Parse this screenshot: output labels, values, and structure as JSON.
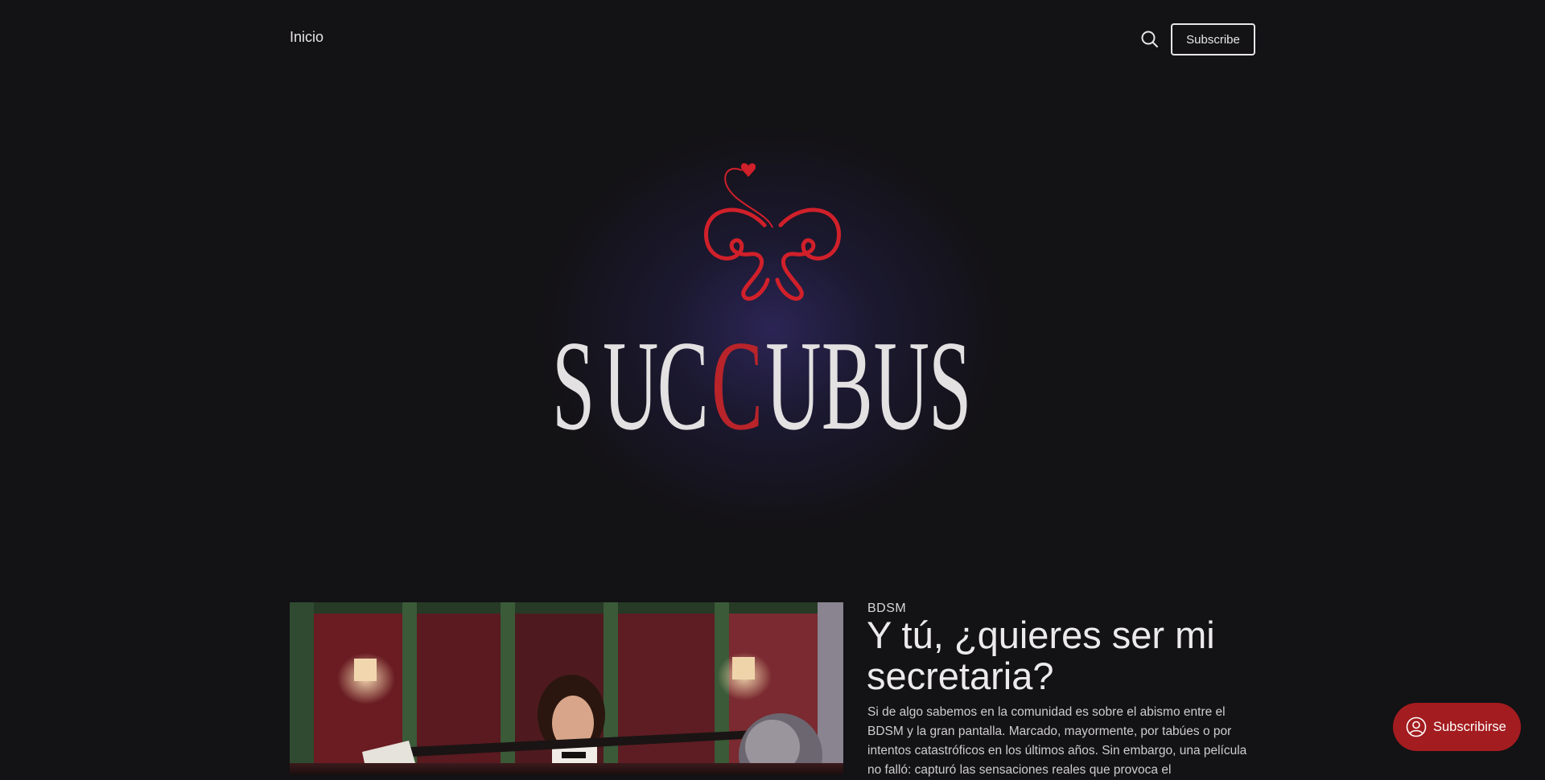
{
  "header": {
    "nav": [
      {
        "label": "Inicio"
      }
    ],
    "search_icon": "search-icon",
    "subscribe_label": "Subscribe"
  },
  "hero": {
    "logo_letters": [
      "S",
      "U",
      "C",
      "C",
      "U",
      "B",
      "U",
      "S"
    ],
    "logo_accent_letter_index": 3,
    "colors": {
      "brand_red": "#d0202a",
      "accent_red": "#b8242a",
      "letters": "#e3e1e1",
      "glow": "#302860"
    }
  },
  "featured": {
    "tag": "BDSM",
    "title": "Y tú, ¿quieres ser mi secretaria?",
    "excerpt": "Si de algo sabemos en la comunidad es sobre el abismo entre el BDSM y la gran pantalla. Marcado, mayormente, por tabúes o por intentos catastróficos en los últimos años. Sin embargo, una película no falló: capturó las sensaciones reales que provoca el"
  },
  "portal": {
    "label": "Subscribirse",
    "icon": "user-circle-icon",
    "color": "#a31c1f"
  }
}
